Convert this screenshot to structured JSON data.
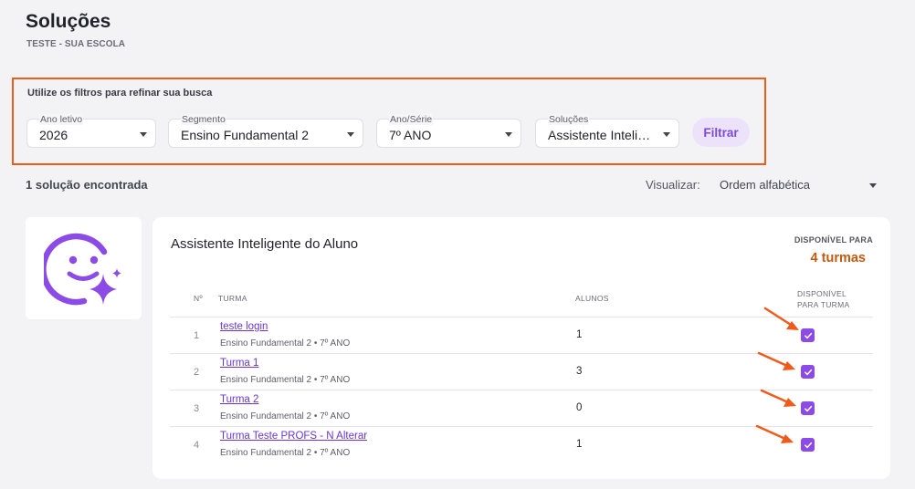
{
  "page": {
    "title": "Soluções",
    "subtitle": "TESTE - SUA ESCOLA"
  },
  "filters": {
    "hint": "Utilize os filtros para refinar sua busca",
    "ano_letivo": {
      "label": "Ano letivo",
      "value": "2026"
    },
    "segmento": {
      "label": "Segmento",
      "value": "Ensino Fundamental 2"
    },
    "ano_serie": {
      "label": "Ano/Série",
      "value": "7º ANO"
    },
    "solucoes": {
      "label": "Soluções",
      "value": "Assistente Inteligente do Aluno"
    },
    "button": "Filtrar"
  },
  "results": {
    "count_text": "1 solução encontrada",
    "view_label": "Visualizar:",
    "view_value": "Ordem alfabética"
  },
  "solution": {
    "title": "Assistente Inteligente do Aluno",
    "available_label": "DISPONÍVEL PARA",
    "available_count": "4 turmas",
    "columns": {
      "num": "Nº",
      "turma": "TURMA",
      "alunos": "ALUNOS",
      "avail_line1": "DISPONÍVEL",
      "avail_line2": "PARA TURMA"
    },
    "rows": [
      {
        "num": "1",
        "name": "teste login",
        "sub": "Ensino Fundamental 2 • 7º ANO",
        "alunos": "1",
        "checked": true
      },
      {
        "num": "2",
        "name": "Turma 1",
        "sub": "Ensino Fundamental 2 • 7º ANO",
        "alunos": "3",
        "checked": true
      },
      {
        "num": "3",
        "name": "Turma 2",
        "sub": "Ensino Fundamental 2 • 7º ANO",
        "alunos": "0",
        "checked": true
      },
      {
        "num": "4",
        "name": "Turma Teste PROFS - N Alterar",
        "sub": "Ensino Fundamental 2 • 7º ANO",
        "alunos": "1",
        "checked": true
      }
    ]
  },
  "colors": {
    "accent": "#8c4be6",
    "highlight": "#f05a1a",
    "count_orange": "#c7580d"
  },
  "icons": {
    "logo": "smiley-sparkle-icon",
    "check": "check-icon",
    "caret": "caret-down-icon",
    "annotation": "arrow-icon"
  }
}
